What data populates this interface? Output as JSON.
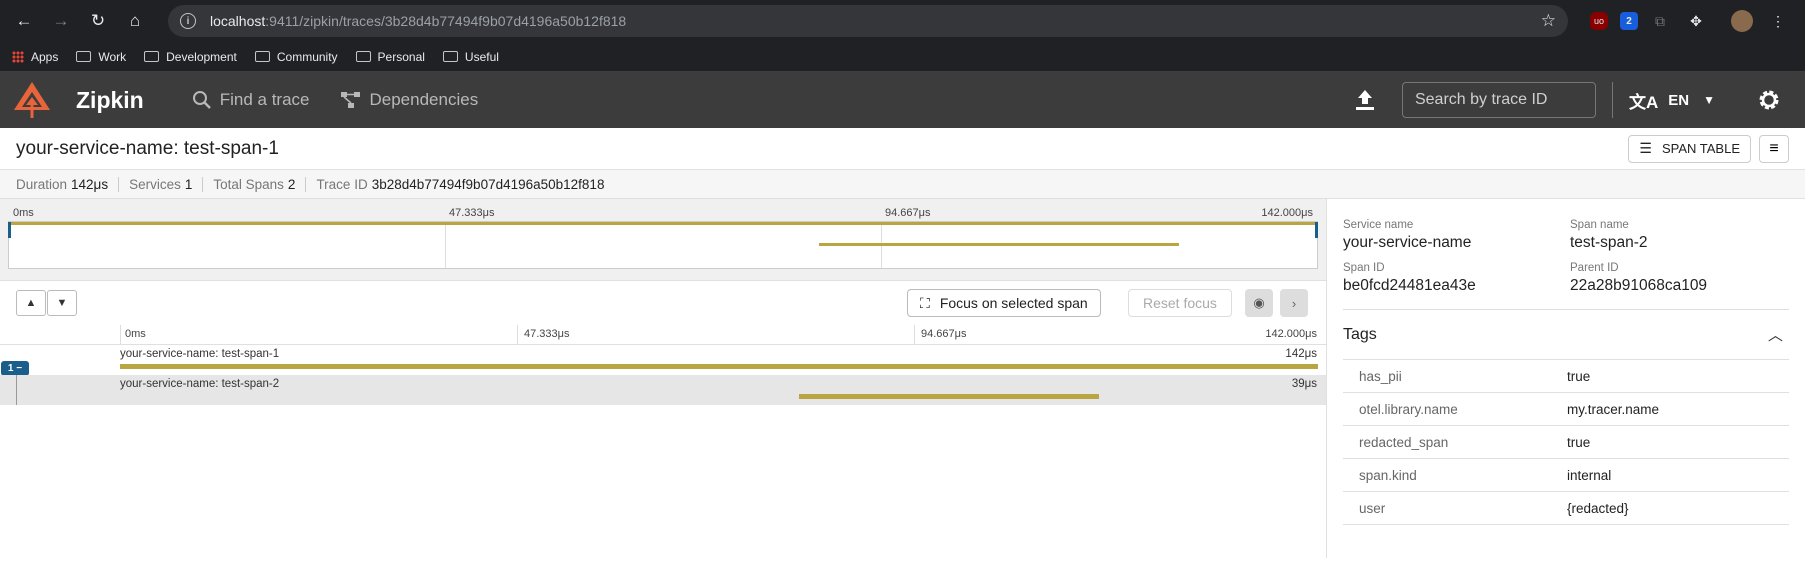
{
  "browser": {
    "url_host": "localhost",
    "url_path": ":9411/zipkin/traces/3b28d4b77494f9b07d4196a50b12f818",
    "bitwarden_badge": "2",
    "bookmarks": [
      "Apps",
      "Work",
      "Development",
      "Community",
      "Personal",
      "Useful"
    ]
  },
  "header": {
    "brand": "Zipkin",
    "nav_find": "Find a trace",
    "nav_deps": "Dependencies",
    "search_placeholder": "Search by trace ID",
    "lang": "EN"
  },
  "trace": {
    "title": "your-service-name: test-span-1",
    "span_table_label": "SPAN TABLE",
    "summary": {
      "duration_label": "Duration",
      "duration": "142μs",
      "services_label": "Services",
      "services": "1",
      "spans_label": "Total Spans",
      "spans": "2",
      "traceid_label": "Trace ID",
      "traceid": "3b28d4b77494f9b07d4196a50b12f818"
    },
    "ticks": [
      "0ms",
      "47.333μs",
      "94.667μs",
      "142.000μs"
    ],
    "focus_label": "Focus on selected span",
    "reset_label": "Reset focus",
    "collapse_badge": "1 −",
    "spans": [
      {
        "name": "your-service-name: test-span-1",
        "duration": "142μs",
        "start_frac": 0.0,
        "width_frac": 1.0
      },
      {
        "name": "your-service-name: test-span-2",
        "duration": "39μs",
        "start_frac": 0.567,
        "width_frac": 0.25
      }
    ]
  },
  "detail": {
    "service_name_label": "Service name",
    "service_name": "your-service-name",
    "span_name_label": "Span name",
    "span_name": "test-span-2",
    "span_id_label": "Span ID",
    "span_id": "be0fcd24481ea43e",
    "parent_id_label": "Parent ID",
    "parent_id": "22a28b91068ca109",
    "tags_title": "Tags",
    "tags": [
      {
        "key": "has_pii",
        "value": "true"
      },
      {
        "key": "otel.library.name",
        "value": "my.tracer.name"
      },
      {
        "key": "redacted_span",
        "value": "true"
      },
      {
        "key": "span.kind",
        "value": "internal"
      },
      {
        "key": "user",
        "value": "{redacted}"
      }
    ]
  },
  "colors": {
    "accent_bar": "#b9a642",
    "header_bg": "#3c3c3c",
    "logo": "#e8643a"
  }
}
